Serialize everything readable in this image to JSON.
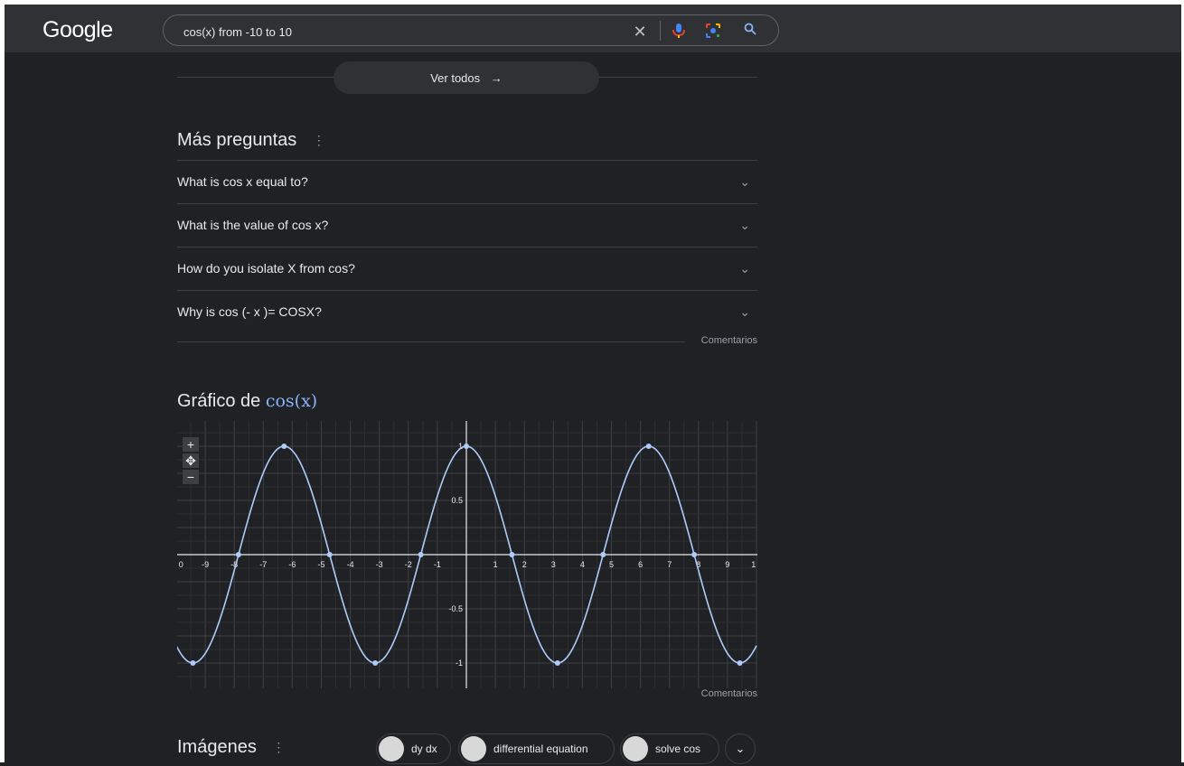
{
  "header": {
    "logo_text": "Google",
    "search_value": "cos(x) from -10 to 10",
    "clear_icon": "close-icon",
    "mic_icon": "mic-icon",
    "lens_icon": "lens-icon",
    "search_icon": "search-icon"
  },
  "view_all": {
    "label": "Ver todos",
    "arrow": "→"
  },
  "more_questions": {
    "title": "Más preguntas",
    "kebab": "⋮",
    "items": [
      {
        "label": "What is cos x equal to?"
      },
      {
        "label": "What is the value of cos x?"
      },
      {
        "label": "How do you isolate X from cos?"
      },
      {
        "label": "Why is cos (- x )= COSX?"
      }
    ],
    "feedback": "Comentarios"
  },
  "graph": {
    "title_prefix": "Gráfico de",
    "title_math": "cos(x)",
    "feedback": "Comentarios",
    "zoom_in": "+",
    "zoom_out": "−",
    "pan": "✥"
  },
  "chart_data": {
    "type": "line",
    "function": "cos(x)",
    "xlim": [
      -10,
      10
    ],
    "ylim": [
      -1.2,
      1.2
    ],
    "x_ticks": [
      "0",
      "-9",
      "-8",
      "-7",
      "-6",
      "-5",
      "-4",
      "-3",
      "-2",
      "-1",
      "1",
      "2",
      "3",
      "4",
      "5",
      "6",
      "7",
      "8",
      "9",
      "1"
    ],
    "y_ticks": [
      "1",
      "0.5",
      "-0.5",
      "-1"
    ],
    "grid": true,
    "series": [
      {
        "x": [
          -10,
          -9.5,
          -9,
          -8.5,
          -8,
          -7.5,
          -7,
          -6.5,
          -6,
          -5.5,
          -5,
          -4.5,
          -4,
          -3.5,
          -3,
          -2.5,
          -2,
          -1.5,
          -1,
          -0.5,
          0,
          0.5,
          1,
          1.5,
          2,
          2.5,
          3,
          3.5,
          4,
          4.5,
          5,
          5.5,
          6,
          6.5,
          7,
          7.5,
          8,
          8.5,
          9,
          9.5,
          10
        ],
        "y": [
          -0.839,
          -0.997,
          -0.911,
          -0.602,
          -0.146,
          0.347,
          0.754,
          0.977,
          0.96,
          0.709,
          0.284,
          -0.211,
          -0.654,
          -0.936,
          -0.99,
          -0.801,
          -0.416,
          0.071,
          0.54,
          0.878,
          1.0,
          0.878,
          0.54,
          0.071,
          -0.416,
          -0.801,
          -0.99,
          -0.936,
          -0.654,
          -0.211,
          0.284,
          0.709,
          0.96,
          0.977,
          0.754,
          0.347,
          -0.146,
          -0.602,
          -0.911,
          -0.997,
          -0.839
        ]
      }
    ],
    "marked_points": {
      "x": [
        -9.425,
        -7.854,
        -6.283,
        -4.712,
        -3.142,
        -1.571,
        0,
        1.571,
        3.142,
        4.712,
        6.283,
        7.854,
        9.425
      ],
      "y": [
        -1,
        0,
        1,
        0,
        -1,
        0,
        1,
        0,
        -1,
        0,
        1,
        0,
        -1
      ]
    },
    "line_color": "#aecbfa",
    "axis_color": "#e8eaed"
  },
  "images": {
    "title": "Imágenes",
    "kebab": "⋮",
    "chips": [
      {
        "label": "dy dx"
      },
      {
        "label": "differential equation"
      },
      {
        "label": "solve cos"
      }
    ],
    "more": "⌄"
  }
}
